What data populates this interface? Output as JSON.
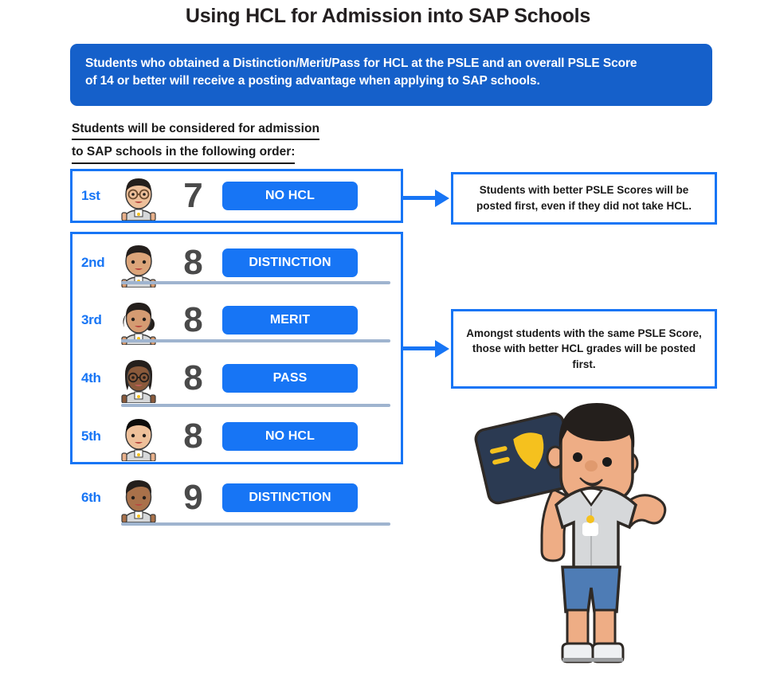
{
  "title": "Using HCL for Admission into SAP Schools",
  "banner": {
    "line1": "Students who obtained a Distinction/Merit/Pass for HCL at the PSLE and an overall PSLE Score",
    "line2": "of 14 or better will receive a posting advantage when applying to SAP schools."
  },
  "section_heading": {
    "line1": "Students will be considered for admission",
    "line2": "to SAP schools in the following order:"
  },
  "ranking": {
    "rows": [
      {
        "rank": "1st",
        "score": "7",
        "grade": "NO HCL",
        "avatar": "student-avatar-boy-glasses"
      },
      {
        "rank": "2nd",
        "score": "8",
        "grade": "DISTINCTION",
        "avatar": "student-avatar-boy-bowlcut"
      },
      {
        "rank": "3rd",
        "score": "8",
        "grade": "MERIT",
        "avatar": "student-avatar-girl-ponytail"
      },
      {
        "rank": "4th",
        "score": "8",
        "grade": "PASS",
        "avatar": "student-avatar-girl-glasses"
      },
      {
        "rank": "5th",
        "score": "8",
        "grade": "NO HCL",
        "avatar": "student-avatar-boy-short"
      },
      {
        "rank": "6th",
        "score": "9",
        "grade": "DISTINCTION",
        "avatar": "student-avatar-boy-swept"
      }
    ]
  },
  "callouts": {
    "first": "Students with better PSLE Scores will be posted first, even if they did not take HCL.",
    "second": "Amongst students with the same PSLE Score, those with better HCL grades will be posted first."
  },
  "illustration": {
    "name": "boy-holding-award-plaque",
    "description": "Cartoon schoolboy in grey polo and blue shorts raising a navy plaque with a gold trophy"
  },
  "colors": {
    "banner_blue": "#1560ca",
    "accent_blue": "#1775f5",
    "score_grey": "#4a4a4a",
    "separator": "#9fb4cf",
    "text_black": "#1a1a1a",
    "gold": "#f5c11e",
    "plaque_navy": "#2b3a52",
    "shirt_grey": "#d6d8da",
    "shorts_blue": "#4e7cb5"
  }
}
